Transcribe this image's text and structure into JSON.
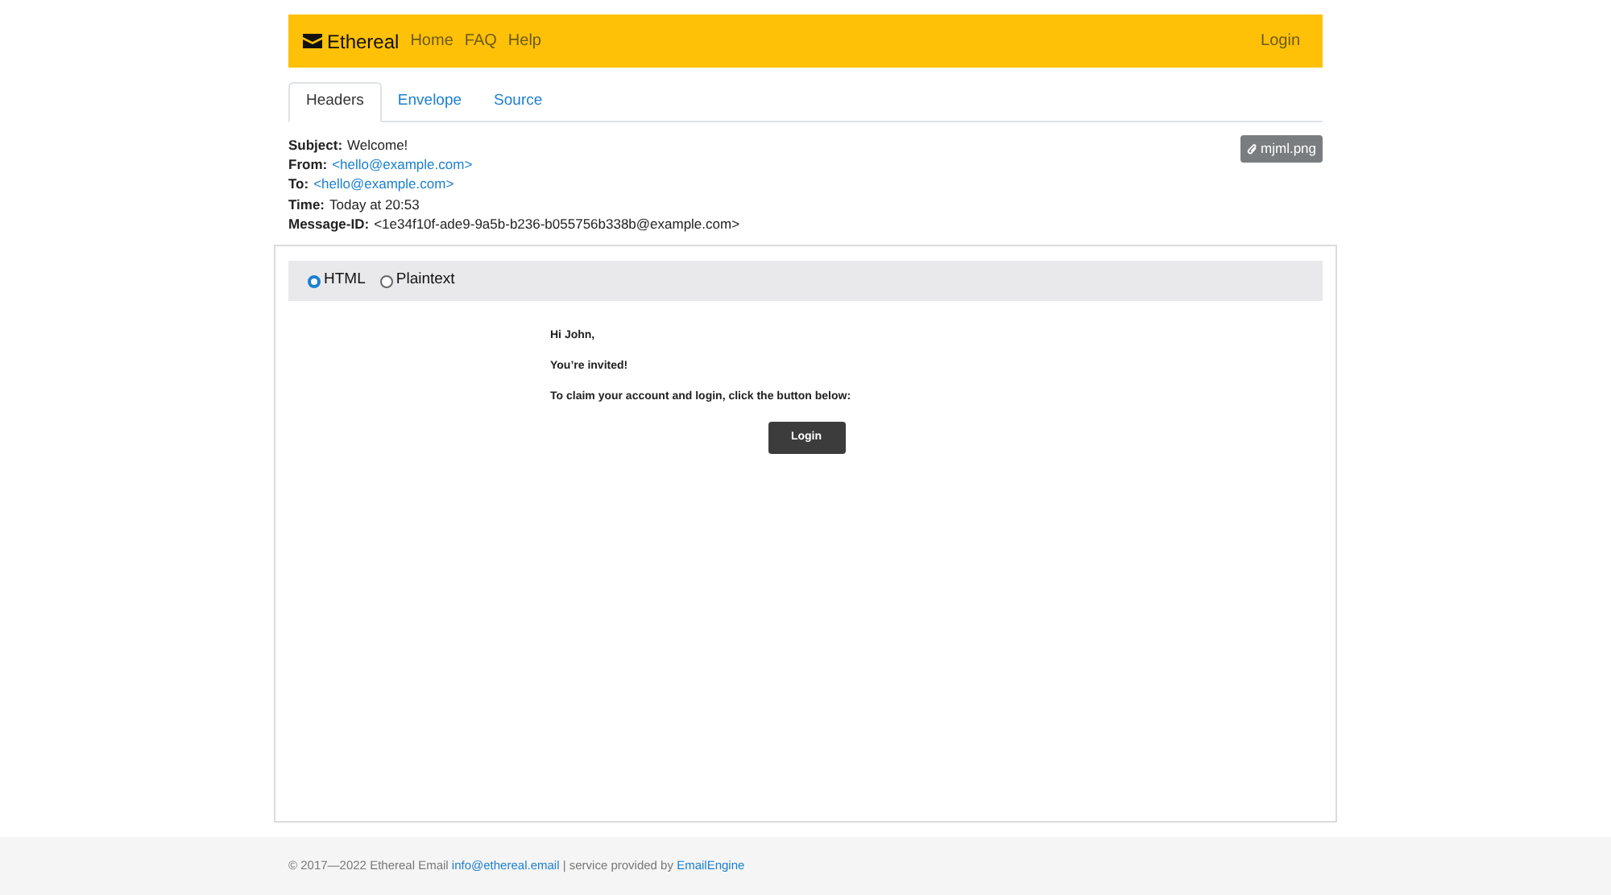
{
  "navbar": {
    "brand": "Ethereal",
    "links": [
      "Home",
      "FAQ",
      "Help"
    ],
    "login": "Login"
  },
  "tabs": [
    {
      "label": "Headers",
      "selected": true
    },
    {
      "label": "Envelope",
      "selected": false
    },
    {
      "label": "Source",
      "selected": false
    }
  ],
  "headers": [
    {
      "label": "Subject:",
      "value": "Welcome!",
      "kind": "text"
    },
    {
      "label": "From:",
      "value": "<hello@example.com>",
      "kind": "link"
    },
    {
      "label": "To:",
      "value": "<hello@example.com>",
      "kind": "link"
    },
    {
      "label": "Time:",
      "value": "Today at 20:53",
      "kind": "text"
    },
    {
      "label": "Message-ID:",
      "value": "<1e34f10f-ade9-9a5b-b236-b055756b338b@example.com>",
      "kind": "text"
    }
  ],
  "attachment": "mjml.png",
  "view_options": [
    {
      "label": "HTML",
      "selected": true
    },
    {
      "label": "Plaintext",
      "selected": false
    }
  ],
  "email": {
    "paragraphs": [
      "Hi John,",
      "You’re invited!",
      "To claim your account and login, click the button below:"
    ],
    "button": "Login"
  },
  "footer": {
    "copyright": "© 2017—2022 Ethereal Email",
    "email_link": "info@ethereal.email",
    "middle": "| service provided by",
    "provider_link": "EmailEngine"
  }
}
